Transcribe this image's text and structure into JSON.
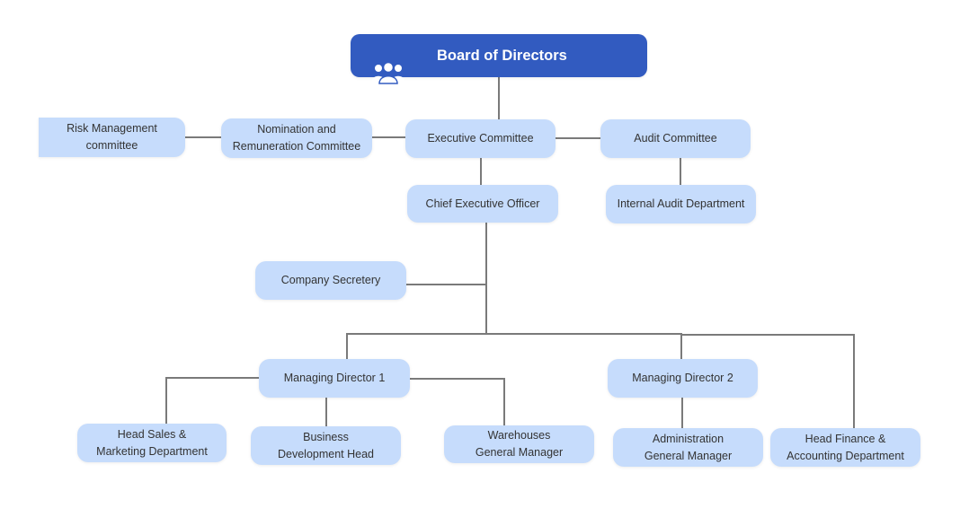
{
  "diagram": {
    "type": "org-chart",
    "colors": {
      "root_fill": "#325bc0",
      "root_text": "#ffffff",
      "node_fill": "#c6dcfc",
      "node_text": "#333333",
      "connector": "#7a7a7a"
    },
    "root": {
      "label": "Board of Directors",
      "icon": "people-group-icon"
    },
    "nodes": {
      "risk": "Risk Management\ncommittee",
      "nomination": "Nomination and\nRemuneration Committee",
      "executive": "Executive  Committee",
      "audit": "Audit  Committee",
      "ceo": "Chief Executive  Officer",
      "internal_audit": "Internal Audit Department",
      "secretary": "Company Secretery",
      "md1": "Managing Director 1",
      "md2": "Managing Director 2",
      "head_sales": "Head Sales &\nMarketing Department",
      "business_dev": "Business\nDevelopment Head",
      "warehouses": "Warehouses\nGeneral Manager",
      "administration": "Administration\nGeneral Manager",
      "head_finance": "Head Finance &\nAccounting Department"
    },
    "edges": [
      [
        "root",
        "executive"
      ],
      [
        "executive",
        "nomination"
      ],
      [
        "nomination",
        "risk"
      ],
      [
        "executive",
        "audit"
      ],
      [
        "executive",
        "ceo"
      ],
      [
        "audit",
        "internal_audit"
      ],
      [
        "ceo",
        "secretary"
      ],
      [
        "ceo",
        "md1"
      ],
      [
        "ceo",
        "md2"
      ],
      [
        "ceo",
        "head_finance"
      ],
      [
        "md1",
        "head_sales"
      ],
      [
        "md1",
        "business_dev"
      ],
      [
        "md1",
        "warehouses"
      ],
      [
        "md2",
        "administration"
      ]
    ]
  }
}
